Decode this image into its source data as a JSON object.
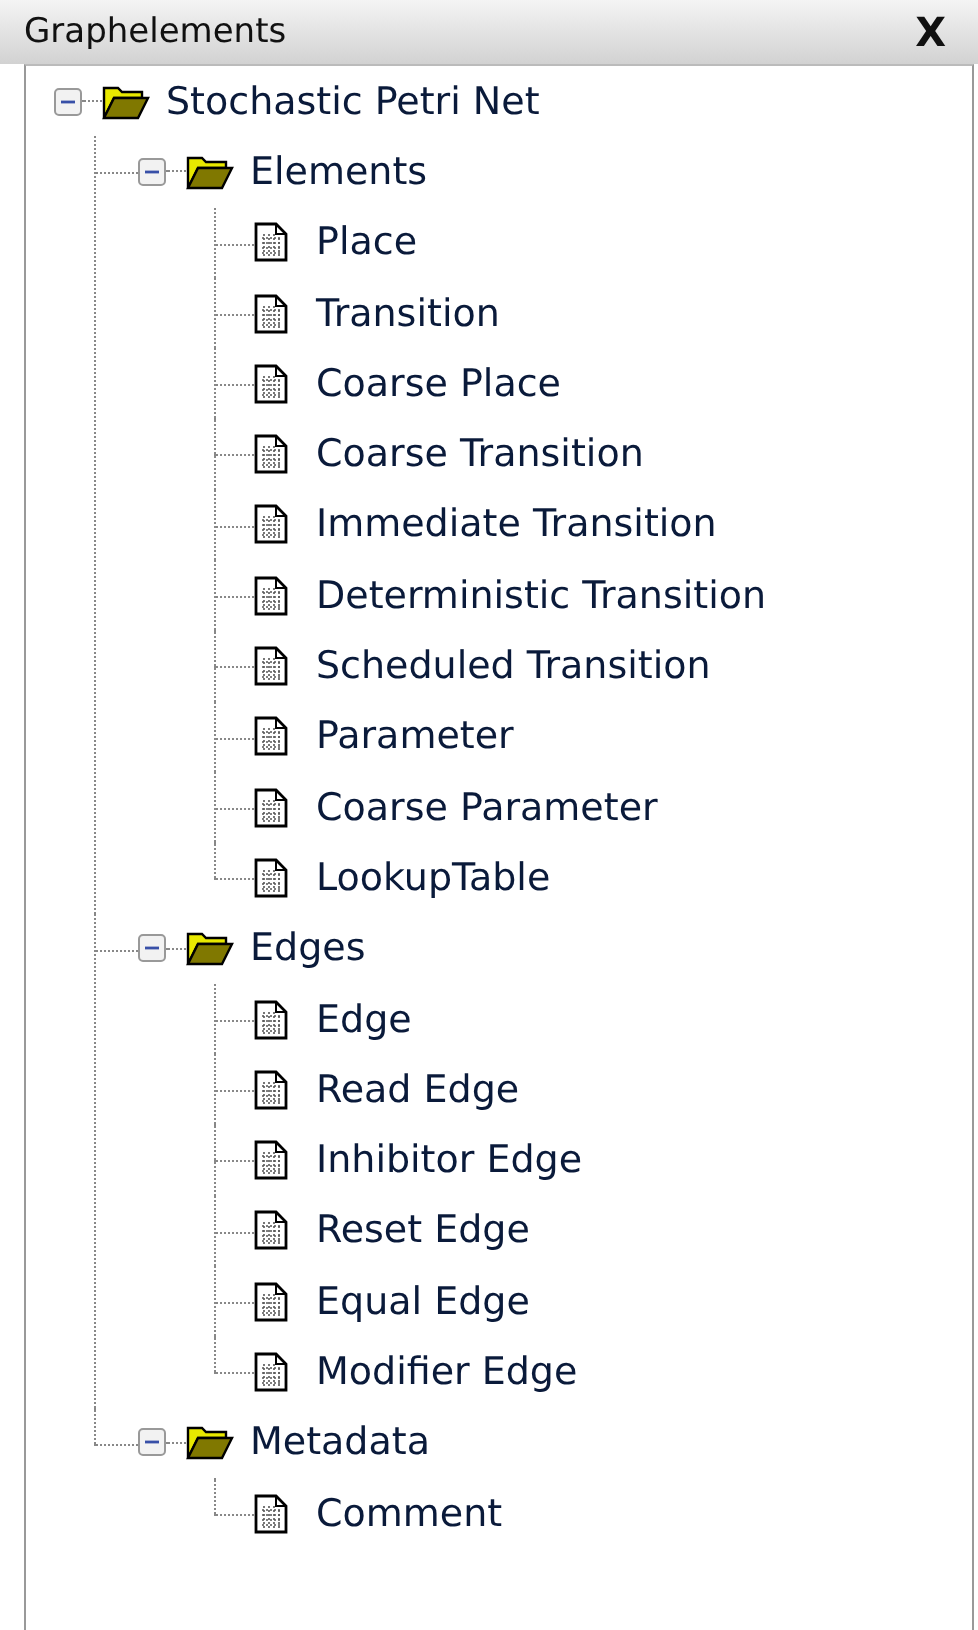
{
  "panel": {
    "title": "Graphelements",
    "close": "X"
  },
  "tree": [
    {
      "label": "Stochastic Petri Net",
      "expanded": true,
      "children": [
        {
          "label": "Elements",
          "expanded": true,
          "children": [
            {
              "label": "Place"
            },
            {
              "label": "Transition"
            },
            {
              "label": "Coarse Place"
            },
            {
              "label": "Coarse Transition"
            },
            {
              "label": "Immediate Transition"
            },
            {
              "label": "Deterministic Transition"
            },
            {
              "label": "Scheduled Transition"
            },
            {
              "label": "Parameter"
            },
            {
              "label": "Coarse Parameter"
            },
            {
              "label": "LookupTable"
            }
          ]
        },
        {
          "label": "Edges",
          "expanded": true,
          "children": [
            {
              "label": "Edge"
            },
            {
              "label": "Read Edge"
            },
            {
              "label": "Inhibitor Edge"
            },
            {
              "label": "Reset Edge"
            },
            {
              "label": "Equal Edge"
            },
            {
              "label": "Modifier Edge"
            }
          ]
        },
        {
          "label": "Metadata",
          "expanded": true,
          "children": [
            {
              "label": "Comment"
            }
          ]
        }
      ]
    }
  ]
}
